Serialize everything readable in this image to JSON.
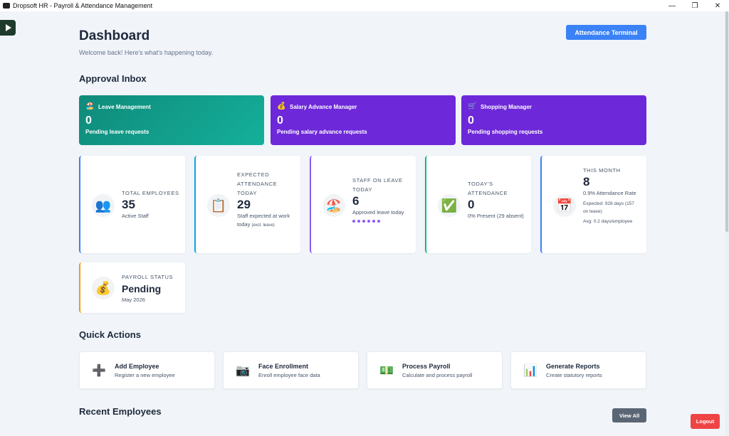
{
  "window": {
    "title": "Dropsoft HR - Payroll & Attendance Management",
    "minimize": "—",
    "maximize": "❐",
    "close": "✕"
  },
  "header": {
    "title": "Dashboard",
    "subtitle": "Welcome back! Here's what's happening today.",
    "terminal_button": "Attendance Terminal"
  },
  "approval_inbox": {
    "title": "Approval Inbox",
    "cards": [
      {
        "icon": "🏖️",
        "label": "Leave Management",
        "count": "0",
        "desc": "Pending leave requests"
      },
      {
        "icon": "💰",
        "label": "Salary Advance Manager",
        "count": "0",
        "desc": "Pending salary advance requests"
      },
      {
        "icon": "🛒",
        "label": "Shopping Manager",
        "count": "0",
        "desc": "Pending shopping requests"
      }
    ]
  },
  "stats": {
    "total_employees": {
      "icon": "👥",
      "label": "TOTAL EMPLOYEES",
      "value": "35",
      "sub": "Active Staff",
      "accent": "#3b82f6"
    },
    "expected_attendance": {
      "icon": "📋",
      "label": "EXPECTED ATTENDANCE TODAY",
      "value": "29",
      "sub": "Staff expected at work today",
      "sub_small": "(excl. leave)",
      "accent": "#0ea5e9"
    },
    "staff_on_leave": {
      "icon": "🏖️",
      "label": "STAFF ON LEAVE TODAY",
      "value": "6",
      "sub": "Approved leave today",
      "dots": 6,
      "accent": "#8b5cf6"
    },
    "todays_attendance": {
      "icon": "✅",
      "label": "TODAY'S ATTENDANCE",
      "value": "0",
      "sub": "0% Present (29 absent)",
      "accent": "#10b981"
    },
    "this_month": {
      "icon": "📅",
      "label": "THIS MONTH",
      "value": "8",
      "sub": "0.9% Attendance Rate",
      "expected": "Expected: 928 days (157 on leave)",
      "avg": "Avg: 0.2 days/employee",
      "accent": "#3b82f6"
    },
    "payroll_status": {
      "icon": "💰",
      "label": "PAYROLL STATUS",
      "value": "Pending",
      "sub": "May 2026",
      "accent": "#f59e0b"
    }
  },
  "quick_actions": {
    "title": "Quick Actions",
    "items": [
      {
        "icon": "➕",
        "title": "Add Employee",
        "sub": "Register a new employee"
      },
      {
        "icon": "📷",
        "title": "Face Enrollment",
        "sub": "Enroll employee face data"
      },
      {
        "icon": "💵",
        "title": "Process Payroll",
        "sub": "Calculate and process payroll"
      },
      {
        "icon": "📊",
        "title": "Generate Reports",
        "sub": "Create statutory reports"
      }
    ]
  },
  "recent_employees": {
    "title": "Recent Employees",
    "view_all": "View All"
  },
  "logout": "Logout"
}
